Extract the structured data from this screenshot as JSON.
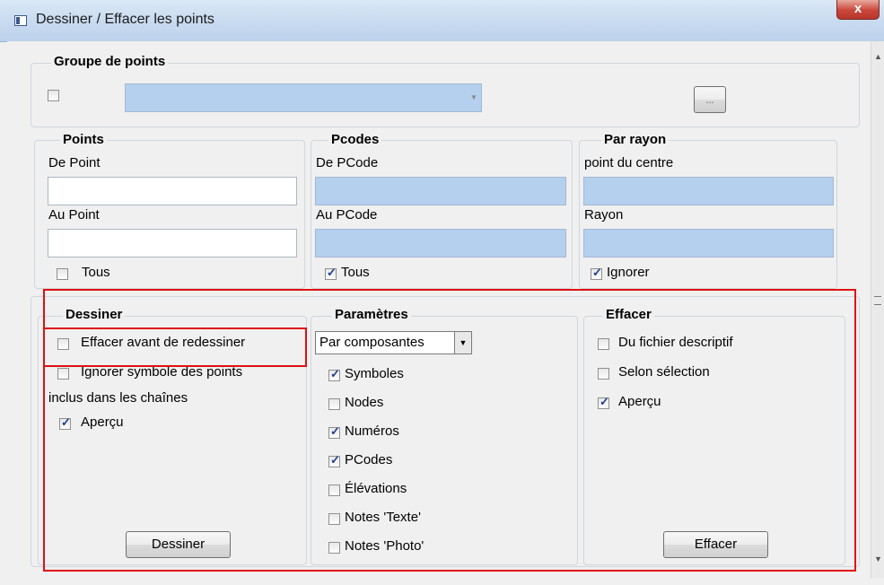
{
  "window": {
    "title": "Dessiner / Effacer les points",
    "close_label": "x"
  },
  "groupe": {
    "legend": "Groupe de points",
    "browse_label": "..."
  },
  "points": {
    "legend": "Points",
    "from_label": "De Point",
    "to_label": "Au Point",
    "from_value": "",
    "to_value": "",
    "all_label": "Tous",
    "all_checked": false
  },
  "pcodes": {
    "legend": "Pcodes",
    "from_label": "De PCode",
    "to_label": "Au PCode",
    "all_label": "Tous",
    "all_checked": true
  },
  "rayon": {
    "legend": "Par rayon",
    "center_label": "point du centre",
    "radius_label": "Rayon",
    "ignore_label": "Ignorer",
    "ignore_checked": true
  },
  "dessiner": {
    "legend": "Dessiner",
    "erase_before_label": "Effacer avant de redessiner",
    "ignore_symbol_label_1": "Ignorer symbole des points",
    "ignore_symbol_label_2": "inclus dans les chaînes",
    "apercu_label": "Aperçu",
    "button_label": "Dessiner"
  },
  "parametres": {
    "legend": "Paramètres",
    "select_value": "Par composantes",
    "options": [
      {
        "label": "Symboles",
        "checked": true
      },
      {
        "label": "Nodes",
        "checked": false
      },
      {
        "label": "Numéros",
        "checked": true
      },
      {
        "label": "PCodes",
        "checked": true
      },
      {
        "label": "Élévations",
        "checked": false
      },
      {
        "label": "Notes 'Texte'",
        "checked": false
      },
      {
        "label": "Notes 'Photo'",
        "checked": false
      }
    ]
  },
  "effacer": {
    "legend": "Effacer",
    "du_fichier_label": "Du fichier descriptif",
    "selon_selection_label": "Selon sélection",
    "apercu_label": "Aperçu",
    "button_label": "Effacer"
  },
  "colors": {
    "highlight": "#e01010",
    "field_blue": "#b4d0ee"
  }
}
